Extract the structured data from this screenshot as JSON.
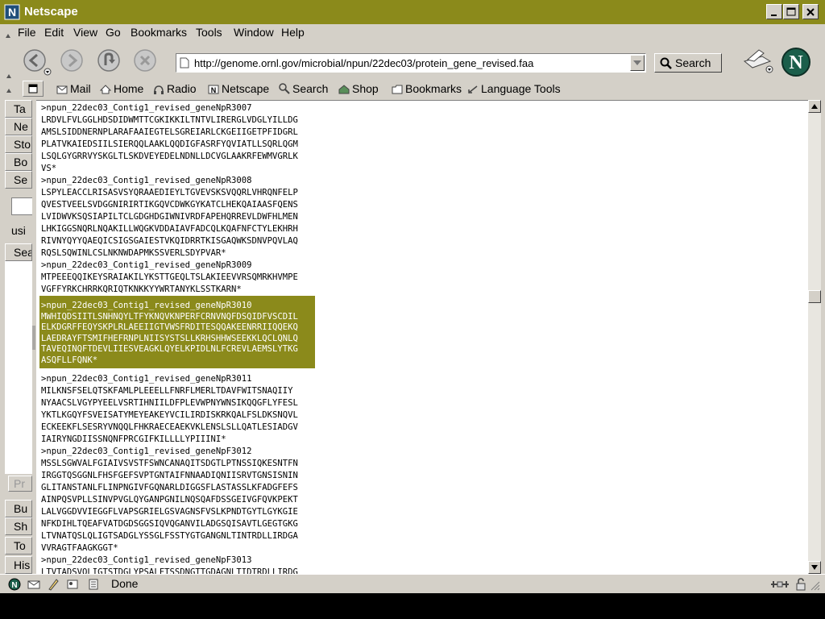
{
  "window": {
    "title": "Netscape"
  },
  "menu": [
    "File",
    "Edit",
    "View",
    "Go",
    "Bookmarks",
    "Tools",
    "Window",
    "Help"
  ],
  "nav": {
    "url": "http://genome.ornl.gov/microbial/npun/22dec03/protein_gene_revised.faa",
    "search_label": "Search"
  },
  "personal_toolbar": [
    "Mail",
    "Home",
    "Radio",
    "Netscape",
    "Search",
    "Shop",
    "Bookmarks",
    "Language Tools"
  ],
  "sidebar": {
    "tabs": [
      "Ta",
      "Ne",
      "Sto",
      "Bo",
      "Se"
    ],
    "text": "usi",
    "bottom_tab": "Sea",
    "bottom_button": "Pr",
    "bottom_tabs": [
      "Bu",
      "Sh",
      "To",
      "His"
    ]
  },
  "content": {
    "lines_before": [
      ">npun_22dec03_Contig1_revised_geneNpR3007",
      "LRDVLFVLGGLHDSDIDWMTTCGKIKKILTNTVLIRERGLVDGLYILLDG",
      "AMSLSIDDNERNPLARAFAAIEGTELSGREIARLCKGEIIGETPFIDGRL",
      "PLATVKAIEDSIILSIERQQLAAKLQQDIGFASRFYQVIATLLSQRLQGM",
      "LSQLGYGRRVYSKGLTLSKDVEYEDELNDNLLDCVGLAAKRFEWMVGRLK",
      "VS*",
      ">npun_22dec03_Contig1_revised_geneNpR3008",
      "LSPYLEACCLRISASVSYQRAAEDIEYLTGVEVSKSVQQRLVHRQNFELP",
      "QVESTVEELSVDGGNIRIRTIKGQVCDWKGYKATCLHEKQAIAASFQENS",
      "LVIDWVKSQSIAPILTCLGDGHDGIWNIVRDFAPEHQRREVLDWFHLMEN",
      "LHKIGGSNQRLNQAKILLWQGKVDDAIAVFADCQLKQAFNFCTYLEKHRH",
      "RIVNYQYYQAEQICSIGSGAIESTVKQIDRRTKISGAQWKSDNVPQVLAQ",
      "RQSLSQWINLCSLNKNWDAPMKSSVERLSDYPVAR*",
      ">npun_22dec03_Contig1_revised_geneNpR3009",
      "MTPEEEQQIKEYSRAIAKILYKSTTGEQLTSLAKIEEVVRSQMRKHVMPE",
      "VGFFYRKCHRRKQRIQTKNKKYYWRTANYKLSSTKARN*"
    ],
    "highlighted": [
      ">npun_22dec03_Contig1_revised_geneNpR3010",
      "MWHIQDSIITLSNHNQYLTFYKNQVKNPERFCRNVNQFDSQIDFVSCDIL",
      "ELKDGRFFEQYSKPLRLAEEIIGTVWSFRDITESQQAKEENRRIIQQEKQ",
      "LAEDRAYFTSMIFHEFRNPLNIISYSTSLLKRHSHHWSEEKKLQCLQNLQ",
      "TAVEQINQFTDEVLIIESVEAGKLQYELKPIDLNLFCREVLAEMSLYTKG",
      "ASQFLLFQNK*"
    ],
    "lines_after": [
      ">npun_22dec03_Contig1_revised_geneNpR3011",
      "MILKNSFSELQTSKFAMLPLEEELLFNRFLMERLTDAVFWITSNAQIIY",
      "NYAACSLVGYPYEELVSRTIHNIILDFPLEVWPNYWNSIKQQGFLYFESL",
      "YKTLKGQYFSVEISATYMEYEAKEYVCILIRDISKRKQALFSLDKSNQVL",
      "ECKEEKFLSESRYVNQQLFHKRAECEAEKVKLENSLSLLQATLESIADGV",
      "IAIRYNGDIISSNQNFPRCGIFKILLLLYPIIINI*",
      ">npun_22dec03_Contig1_revised_geneNpF3012",
      "MSSLSGWVALFGIAIVSVSTFSWNCANAQITSDGTLPTNSSIQKESNTFN",
      "IRGGTQSGGNLFHSFGEFSVPTGNTAIFNNAADIQNIISRVTGNSISNIN",
      "GLITANSTANLFLINPNGIVFGQNARLDIGGSFLASTASSLKFADGFEFS",
      "AINPQSVPLLSINVPVGLQYGANPGNILNQSQAFDSSGEIVGFQVKPEKT",
      "LALVGGDVVIEGGFLVAPSGRIELGSVAGNSFVSLKPNDTGYTLGYKGIE",
      "NFKDIHLTQEAFVATDGDSGGSIQVQGANVILADGSQISAVTLGEGTGKG",
      "LTVNATQSLQLIGTSADGLYSSGLFSSTYGTGANGNLTINTRDLLIRDGA",
      "VVRAGTFAAGKGGT*",
      ">npun_22dec03_Contig1_revised_geneNpF3013",
      "LTVTADSVQLIGTSTDGLYPSALFTSSDNGTTGDAGNLTIDTRDLLIRDG"
    ]
  },
  "status": {
    "text": "Done"
  },
  "colors": {
    "titlebar": "#8b8a1b",
    "highlight": "#8b8a1b",
    "chrome": "#d4d0c8"
  }
}
